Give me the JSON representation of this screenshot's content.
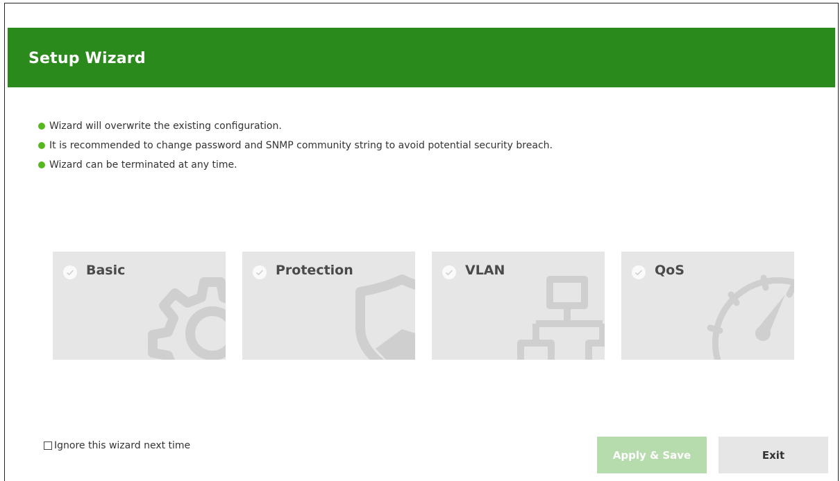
{
  "wizard": {
    "title": "Setup Wizard",
    "notes": [
      "Wizard will overwrite the existing configuration.",
      "It is recommended to change password and SNMP community string to avoid potential security breach.",
      "Wizard can be terminated at any time."
    ],
    "steps": [
      {
        "label": "Basic",
        "icon": "gear-icon"
      },
      {
        "label": "Protection",
        "icon": "shield-icon"
      },
      {
        "label": "VLAN",
        "icon": "network-topology-icon"
      },
      {
        "label": "QoS",
        "icon": "speedometer-icon"
      }
    ],
    "ignore_label": "Ignore this wizard next time",
    "ignore_checked": false,
    "apply_label": "Apply & Save",
    "exit_label": "Exit"
  },
  "colors": {
    "header": "#2b8a1c",
    "bullet": "#56b81e",
    "card_bg": "#e6e6e6",
    "apply_bg": "#b6dcae",
    "exit_bg": "#e6e6e6"
  }
}
